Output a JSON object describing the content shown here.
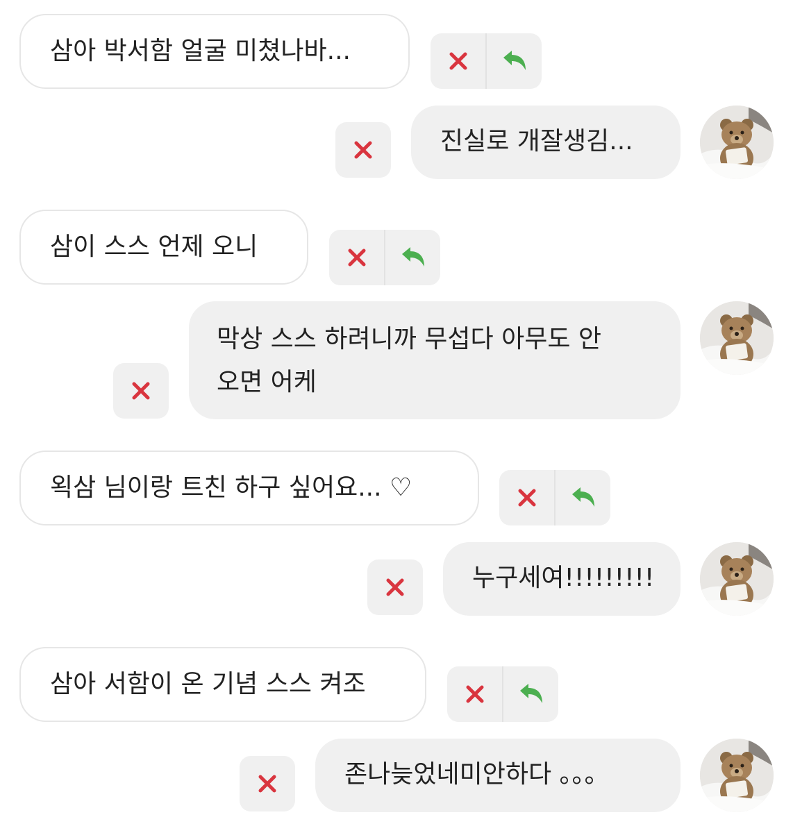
{
  "colors": {
    "incoming_bubble_bg": "#ffffff",
    "incoming_bubble_border": "#e6e6e6",
    "outgoing_bubble_bg": "#f0f0f0",
    "action_bg": "#f0f0f0",
    "delete_icon": "#d9353f",
    "reply_icon": "#4caf50"
  },
  "icons": {
    "delete": "close-x-icon",
    "reply": "reply-arrow-icon",
    "avatar": "teddy-bear-avatar"
  },
  "messages": [
    {
      "direction": "incoming",
      "text": "삼아 박서함 얼굴 미쳤나바..."
    },
    {
      "direction": "outgoing",
      "text": "진실로 개잘생김..."
    },
    {
      "direction": "incoming",
      "text": "삼이 스스 언제 오니"
    },
    {
      "direction": "outgoing",
      "lines": [
        "막상 스스 하려니까 무섭다 아무도 안",
        "오면 어케"
      ]
    },
    {
      "direction": "incoming",
      "text": "왹삼 님이랑 트친 하구 싶어요... ♡"
    },
    {
      "direction": "outgoing",
      "text": "누구세여!!!!!!!!!"
    },
    {
      "direction": "incoming",
      "text": "삼아 서함이 온 기념 스스 켜조"
    },
    {
      "direction": "outgoing",
      "text": "존나늦었네미안하다 。。。"
    }
  ]
}
